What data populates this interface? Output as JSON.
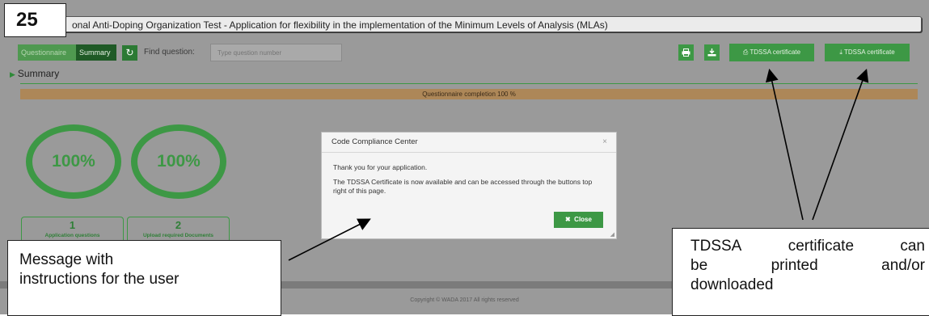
{
  "step_badge": "25",
  "window_title": "onal Anti-Doping Organization Test - Application for flexibility in the implementation of the Minimum Levels of Analysis (MLAs)",
  "toolbar": {
    "tab_questionnaire": "Questionnaire",
    "tab_summary": "Summary",
    "refresh_icon": "refresh-icon",
    "find_label": "Find question:",
    "find_placeholder": "Type question number",
    "print_icon": "print-icon",
    "download_icon": "download-icon",
    "cert_print_label": "TDSSA certificate",
    "cert_download_label": "TDSSA certificate"
  },
  "summary": {
    "heading": "Summary",
    "completion_text": "Questionnaire completion 100 %",
    "circle1": "100%",
    "circle2": "100%",
    "counter1": {
      "number": "1",
      "label": "Application questions"
    },
    "counter2": {
      "number": "2",
      "label": "Upload required Documents"
    }
  },
  "modal": {
    "title": "Code Compliance Center",
    "close_glyph": "×",
    "paragraph1": "Thank you for your application.",
    "paragraph2": "The TDSSA Certificate is now available and can be accessed through the buttons top right of this page.",
    "close_button": "Close",
    "close_button_glyph": "✖"
  },
  "footer": {
    "copyright": "Copyright © WADA 2017 All rights reserved"
  },
  "callouts": {
    "left_line1": "Message with",
    "left_line2": "instructions for the user",
    "right_line1_words": [
      "TDSSA",
      "certificate",
      "can"
    ],
    "right_line2_words": [
      "be",
      "printed",
      "and/or"
    ],
    "right_line3": "downloaded"
  },
  "colors": {
    "accent_green": "#3d9845",
    "dark_green": "#1f5a26",
    "progress_brown": "#ad8758",
    "overlay_gray": "#9a9a9a"
  }
}
